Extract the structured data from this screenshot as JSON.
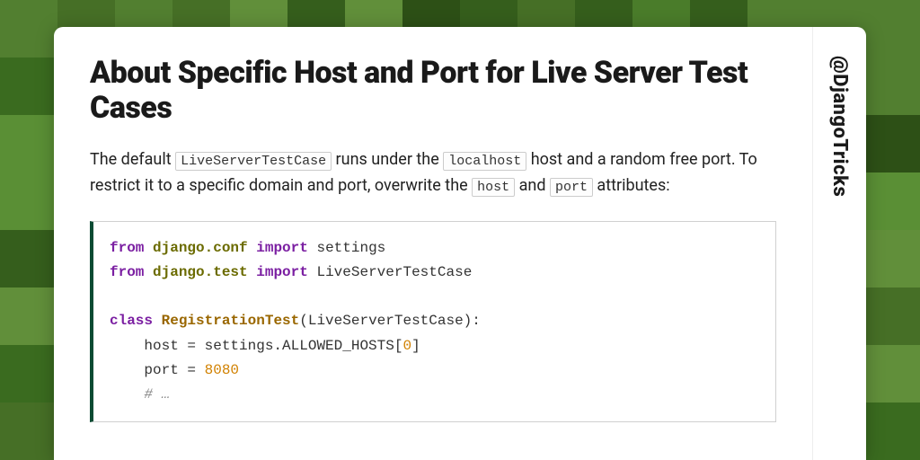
{
  "title": "About Specific Host and Port for Live Server Test Cases",
  "handle": "@DjangoTricks",
  "desc": {
    "t1": "The default ",
    "c1": "LiveServerTestCase",
    "t2": " runs under the ",
    "c2": "localhost",
    "t3": " host and a random free port. To restrict it to a specific domain and port, overwrite the ",
    "c3": "host",
    "t4": " and ",
    "c4": "port",
    "t5": " attributes:"
  },
  "code": {
    "l1": {
      "kw1": "from",
      "mod1": "django.conf",
      "kw2": "import",
      "rest": " settings"
    },
    "l2": {
      "kw1": "from",
      "mod1": "django.test",
      "kw2": "import",
      "rest": " LiveServerTestCase"
    },
    "l3": "",
    "l4": {
      "kw1": "class",
      "cls": "RegistrationTest",
      "rest": "(LiveServerTestCase):"
    },
    "l5": {
      "indent": "    host = settings.ALLOWED_HOSTS[",
      "num": "0",
      "close": "]"
    },
    "l6": {
      "indent": "    port = ",
      "num": "8080"
    },
    "l7": {
      "indent": "    ",
      "cmt": "# …"
    }
  },
  "bg_palette": [
    "#2d5016",
    "#3a6b1f",
    "#4a7c2a",
    "#5a8f35",
    "#618f3a",
    "#355e1c",
    "#466f26",
    "#527f30"
  ]
}
